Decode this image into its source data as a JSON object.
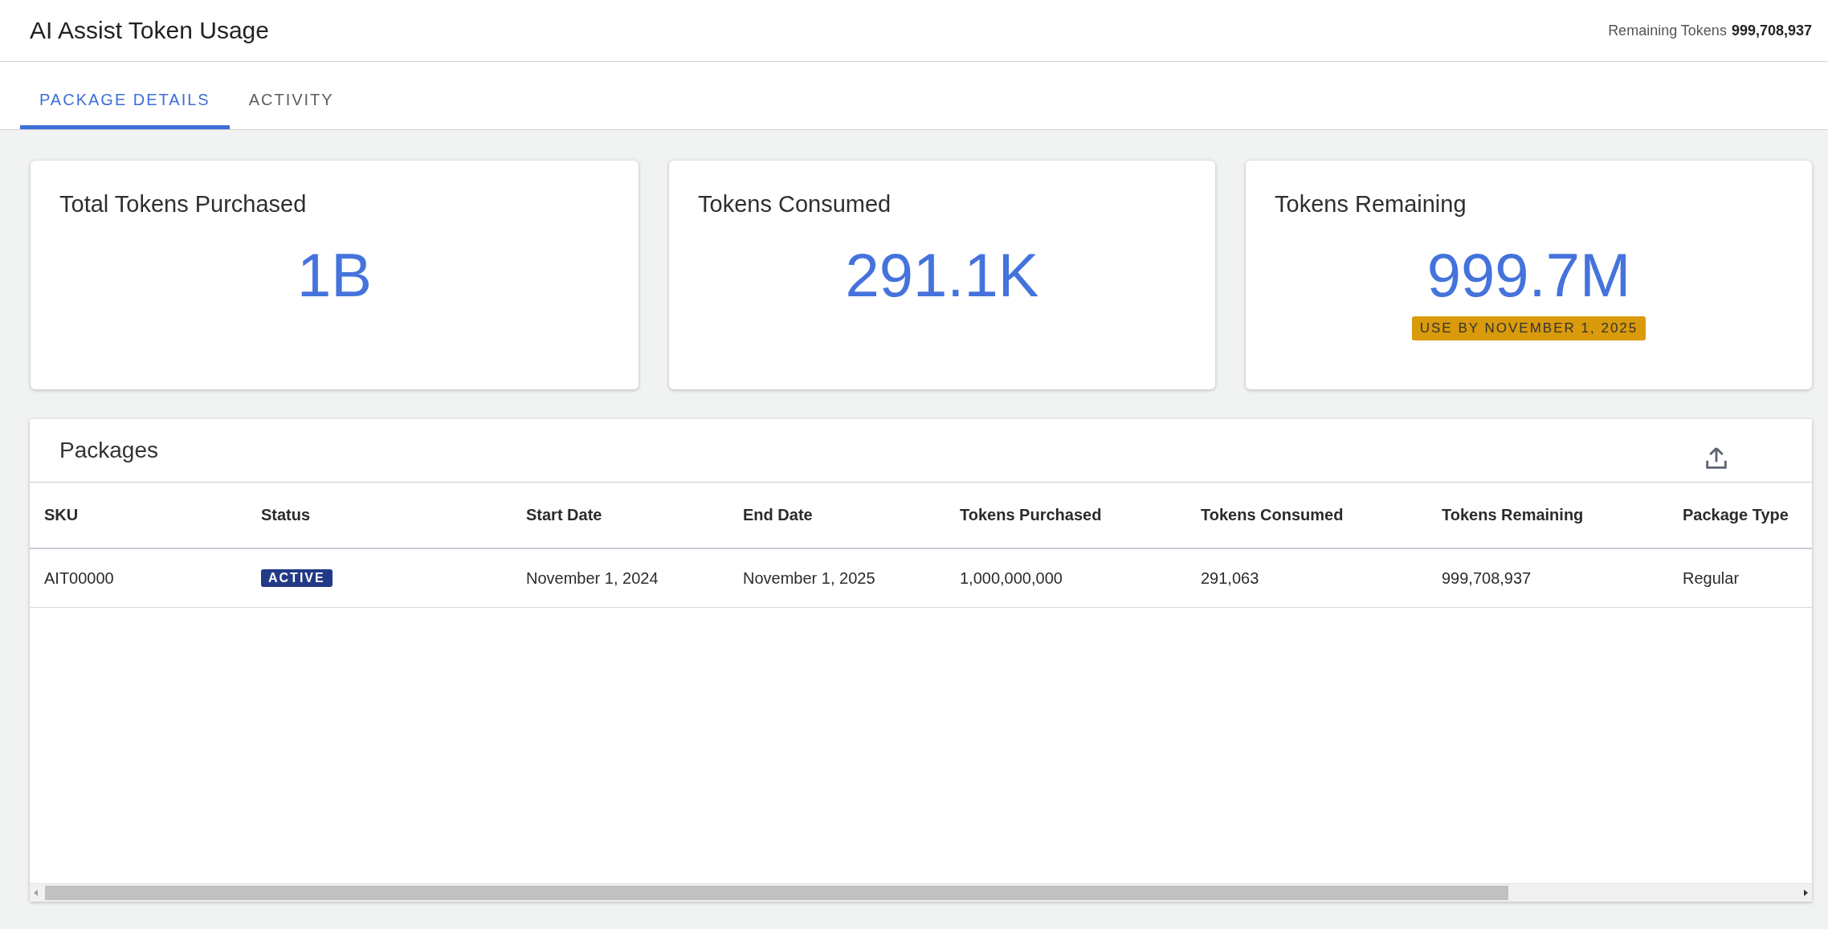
{
  "header": {
    "title": "AI Assist Token Usage",
    "remaining_label": "Remaining Tokens",
    "remaining_value": "999,708,937"
  },
  "tabs": [
    {
      "label": "PACKAGE DETAILS",
      "selected": true
    },
    {
      "label": "ACTIVITY",
      "selected": false
    }
  ],
  "cards": [
    {
      "title": "Total Tokens Purchased",
      "value": "1B"
    },
    {
      "title": "Tokens Consumed",
      "value": "291.1K"
    },
    {
      "title": "Tokens Remaining",
      "value": "999.7M",
      "badge": "USE BY NOVEMBER 1, 2025"
    }
  ],
  "packages": {
    "title": "Packages",
    "columns": [
      "SKU",
      "Status",
      "Start Date",
      "End Date",
      "Tokens Purchased",
      "Tokens Consumed",
      "Tokens Remaining",
      "Package Type"
    ],
    "rows": [
      {
        "sku": "AIT00000",
        "status": {
          "label": "ACTIVE",
          "kind": "active"
        },
        "start_date": "November 1, 2024",
        "end_date": "November 1, 2025",
        "tokens_purchased": "1,000,000,000",
        "tokens_consumed": "291,063",
        "tokens_remaining": "999,708,937",
        "package_type": "Regular"
      }
    ]
  }
}
